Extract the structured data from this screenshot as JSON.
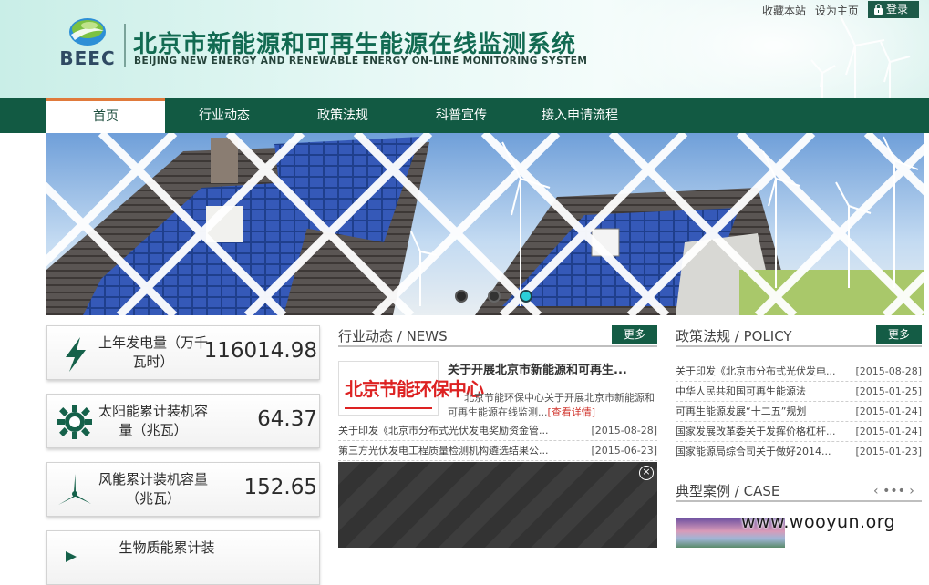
{
  "header": {
    "logo_text": "BEEC",
    "title": "北京市新能源和可再生能源在线监测系统",
    "subtitle": "BEIJING NEW ENERGY AND RENEWABLE ENERGY ON-LINE MONITORING SYSTEM",
    "top_links": [
      "收藏本站",
      "设为主页"
    ],
    "login_label": "登录"
  },
  "nav": {
    "items": [
      "首页",
      "行业动态",
      "政策法规",
      "科普宣传",
      "接入申请流程"
    ],
    "active_index": 0
  },
  "banner": {
    "slide_count": 3,
    "active_slide": 3
  },
  "stats": [
    {
      "label": "上年发电量（万千瓦时）",
      "value": "116014.98",
      "icon": "lightning-icon"
    },
    {
      "label": "太阳能累计装机容量（兆瓦）",
      "value": "64.37",
      "icon": "sun-gear-icon"
    },
    {
      "label": "风能累计装机容量（兆瓦）",
      "value": "152.65",
      "icon": "wind-turbine-icon"
    },
    {
      "label": "生物质能累计装",
      "value": "",
      "icon": "biomass-icon"
    }
  ],
  "news": {
    "title": "行业动态 / NEWS",
    "more_label": "更多",
    "thumb_text": "北京节能环保中心",
    "featured_title": "关于开展北京市新能源和可再生...",
    "featured_summary": "北京节能环保中心关于开展北京市新能源和可再生能源在线监测...",
    "featured_more": "[查看详情]",
    "items": [
      {
        "title": "关于印发《北京市分布式光伏发电奖励资金管...",
        "date": "[2015-08-28]"
      },
      {
        "title": "第三方光伏发电工程质量检测机构遴选结果公...",
        "date": "[2015-06-23]"
      }
    ]
  },
  "policy": {
    "title": "政策法规 / POLICY",
    "more_label": "更多",
    "items": [
      {
        "title": "关于印发《北京市分布式光伏发电...",
        "date": "[2015-08-28]"
      },
      {
        "title": "中华人民共和国可再生能源法",
        "date": "[2015-01-25]"
      },
      {
        "title": "可再生能源发展“十二五”规划",
        "date": "[2015-01-24]"
      },
      {
        "title": "国家发展改革委关于发挥价格杠杆...",
        "date": "[2015-01-24]"
      },
      {
        "title": "国家能源局综合司关于做好2014...",
        "date": "[2015-01-23]"
      }
    ]
  },
  "case": {
    "title": "典型案例 / CASE",
    "prev": "‹",
    "dots": "•••",
    "next": "›"
  },
  "video": {
    "close": "×"
  },
  "watermark": "www.wooyun.org",
  "colors": {
    "brand_green": "#125a43",
    "accent_orange": "#e07a3b",
    "link_red": "#d0342c",
    "dot_active": "#2bd0d9"
  }
}
